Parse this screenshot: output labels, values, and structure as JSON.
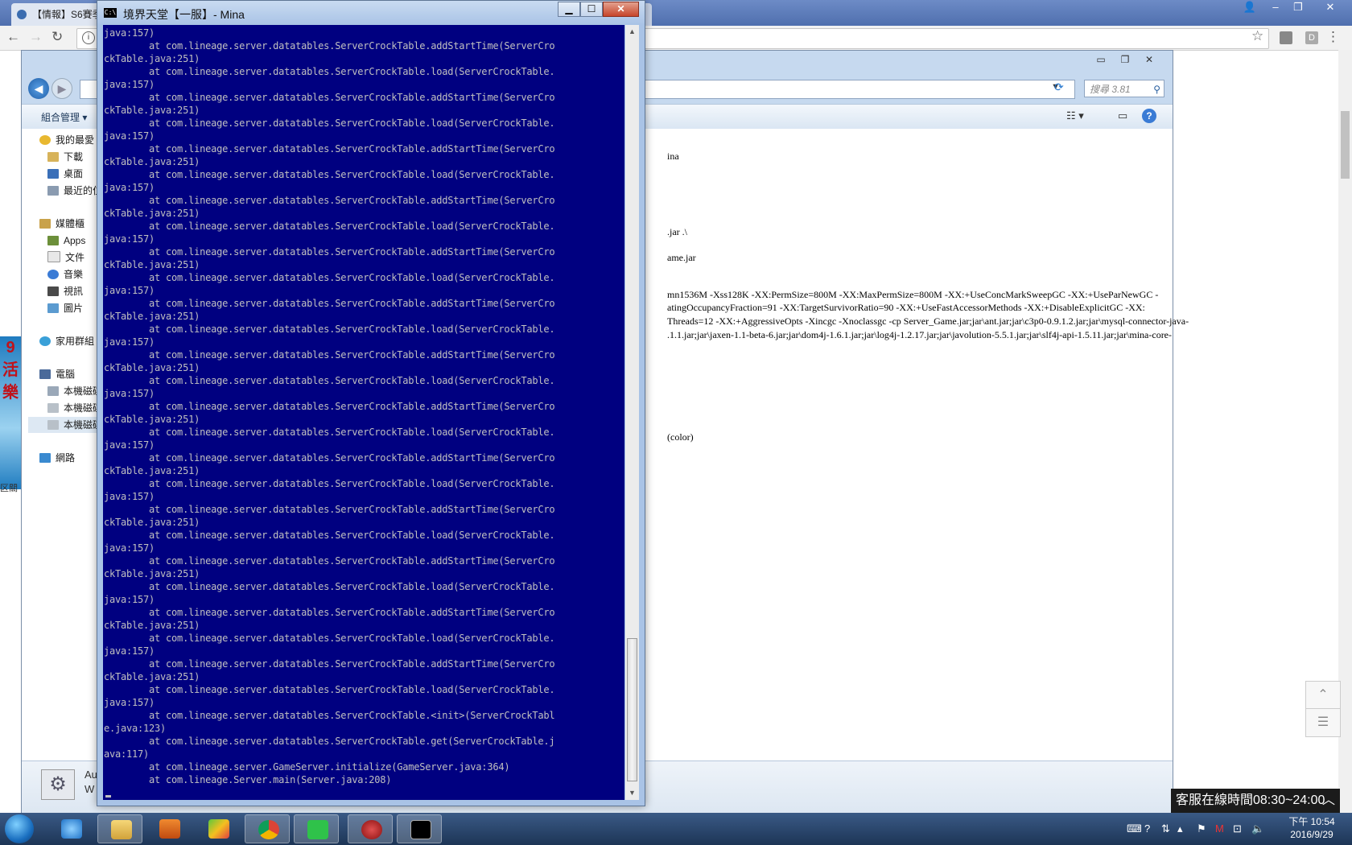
{
  "browser": {
    "tab_title": "【情報】S6賽季",
    "tab_search_label": "搜尋 3.81"
  },
  "explorer": {
    "organize_label": "組合管理 ▾",
    "search_placeholder": "搜尋 3.81",
    "nav": {
      "favorites": "我的最愛",
      "downloads": "下載",
      "desktop": "桌面",
      "recent": "最近的位",
      "libraries": "媒體櫃",
      "apps": "Apps",
      "documents": "文件",
      "music": "音樂",
      "videos": "視訊",
      "pictures": "圖片",
      "homegroup": "家用群組",
      "computer": "電腦",
      "disk_c": "本機磁碟",
      "disk_d": "本機磁碟",
      "disk_e": "本機磁碟",
      "network": "網路"
    },
    "content_lines": [
      "ina",
      ".jar .\\",
      "ame.jar",
      "mn1536M -Xss128K -XX:PermSize=800M -XX:MaxPermSize=800M -XX:+UseConcMarkSweepGC -XX:+UseParNewGC -",
      "atingOccupancyFraction=91 -XX:TargetSurvivorRatio=90 -XX:+UseFastAccessorMethods -XX:+DisableExplicitGC -XX:",
      "Threads=12 -XX:+AggressiveOpts -Xincgc -Xnoclassgc -cp Server_Game.jar;jar\\ant.jar;jar\\c3p0-0.9.1.2.jar;jar\\mysql-connector-java-",
      ".1.1.jar;jar\\jaxen-1.1-beta-6.jar;jar\\dom4j-1.6.1.jar;jar\\log4j-1.2.17.jar;jar\\javolution-5.5.1.jar;jar\\slf4j-api-1.5.11.jar;jar\\mina-core-",
      "(color)"
    ],
    "details_text": "Au\nW"
  },
  "console": {
    "title": "境界天堂【一服】- Mina",
    "lines": [
      "java:157)",
      "        at com.lineage.server.datatables.ServerCrockTable.addStartTime(ServerCro",
      "ckTable.java:251)",
      "        at com.lineage.server.datatables.ServerCrockTable.load(ServerCrockTable.",
      "java:157)",
      "        at com.lineage.server.datatables.ServerCrockTable.addStartTime(ServerCro",
      "ckTable.java:251)",
      "        at com.lineage.server.datatables.ServerCrockTable.load(ServerCrockTable.",
      "java:157)",
      "        at com.lineage.server.datatables.ServerCrockTable.addStartTime(ServerCro",
      "ckTable.java:251)",
      "        at com.lineage.server.datatables.ServerCrockTable.load(ServerCrockTable.",
      "java:157)",
      "        at com.lineage.server.datatables.ServerCrockTable.addStartTime(ServerCro",
      "ckTable.java:251)",
      "        at com.lineage.server.datatables.ServerCrockTable.load(ServerCrockTable.",
      "java:157)",
      "        at com.lineage.server.datatables.ServerCrockTable.addStartTime(ServerCro",
      "ckTable.java:251)",
      "        at com.lineage.server.datatables.ServerCrockTable.load(ServerCrockTable.",
      "java:157)",
      "        at com.lineage.server.datatables.ServerCrockTable.addStartTime(ServerCro",
      "ckTable.java:251)",
      "        at com.lineage.server.datatables.ServerCrockTable.load(ServerCrockTable.",
      "java:157)",
      "        at com.lineage.server.datatables.ServerCrockTable.addStartTime(ServerCro",
      "ckTable.java:251)",
      "        at com.lineage.server.datatables.ServerCrockTable.load(ServerCrockTable.",
      "java:157)",
      "        at com.lineage.server.datatables.ServerCrockTable.addStartTime(ServerCro",
      "ckTable.java:251)",
      "        at com.lineage.server.datatables.ServerCrockTable.load(ServerCrockTable.",
      "java:157)",
      "        at com.lineage.server.datatables.ServerCrockTable.addStartTime(ServerCro",
      "ckTable.java:251)",
      "        at com.lineage.server.datatables.ServerCrockTable.load(ServerCrockTable.",
      "java:157)",
      "        at com.lineage.server.datatables.ServerCrockTable.addStartTime(ServerCro",
      "ckTable.java:251)",
      "        at com.lineage.server.datatables.ServerCrockTable.load(ServerCrockTable.",
      "java:157)",
      "        at com.lineage.server.datatables.ServerCrockTable.addStartTime(ServerCro",
      "ckTable.java:251)",
      "        at com.lineage.server.datatables.ServerCrockTable.load(ServerCrockTable.",
      "java:157)",
      "        at com.lineage.server.datatables.ServerCrockTable.addStartTime(ServerCro",
      "ckTable.java:251)",
      "        at com.lineage.server.datatables.ServerCrockTable.load(ServerCrockTable.",
      "java:157)",
      "        at com.lineage.server.datatables.ServerCrockTable.addStartTime(ServerCro",
      "ckTable.java:251)",
      "        at com.lineage.server.datatables.ServerCrockTable.load(ServerCrockTable.",
      "java:157)",
      "        at com.lineage.server.datatables.ServerCrockTable.<init>(ServerCrockTabl",
      "e.java:123)",
      "        at com.lineage.server.datatables.ServerCrockTable.get(ServerCrockTable.j",
      "ava:117)",
      "        at com.lineage.server.GameServer.initialize(GameServer.java:364)",
      "        at com.lineage.Server.main(Server.java:208)"
    ]
  },
  "page": {
    "service_text": "客服在線時間08:30~24:00",
    "ad_text": "9\n活\n樂",
    "ad_caption": "区關"
  },
  "taskbar": {
    "clock_ampm_time": "下午 10:54",
    "clock_date": "2016/9/29"
  },
  "icons": {
    "start": "windows-start-orb",
    "ie": "internet-explorer-icon",
    "explorer": "file-explorer-icon",
    "media": "media-player-icon",
    "bluestacks": "bluestacks-icon",
    "chrome": "chrome-icon",
    "line": "line-messenger-icon",
    "game": "game-client-icon",
    "cmd": "command-prompt-icon"
  }
}
